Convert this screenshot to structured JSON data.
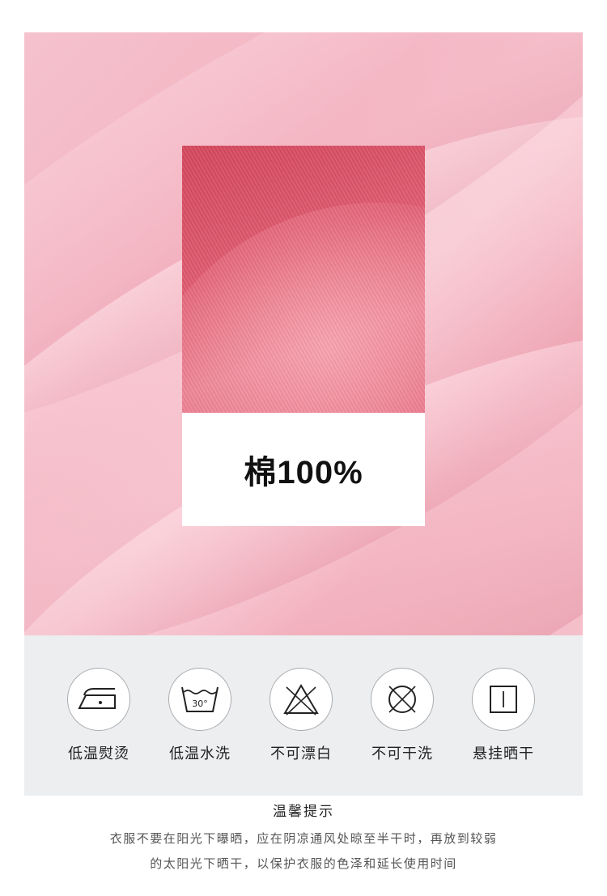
{
  "hero": {
    "material_label": "棉100%",
    "colors": {
      "fabric": "#f3b3c0",
      "swatch": "#dc4f65"
    }
  },
  "care": {
    "items": [
      {
        "icon": "low-temp-iron-icon",
        "label": "低温熨烫"
      },
      {
        "icon": "wash-30-icon",
        "label": "低温水洗",
        "temp": "30°"
      },
      {
        "icon": "no-bleach-icon",
        "label": "不可漂白"
      },
      {
        "icon": "no-dry-clean-icon",
        "label": "不可干洗"
      },
      {
        "icon": "hang-dry-icon",
        "label": "悬挂晒干"
      }
    ]
  },
  "notes": {
    "title": "温馨提示",
    "lines": [
      "衣服不要在阳光下曝晒，应在阴凉通风处晾至半干时，再放到较弱",
      "的太阳光下晒干，以保护衣服的色泽和延长使用时间"
    ]
  }
}
